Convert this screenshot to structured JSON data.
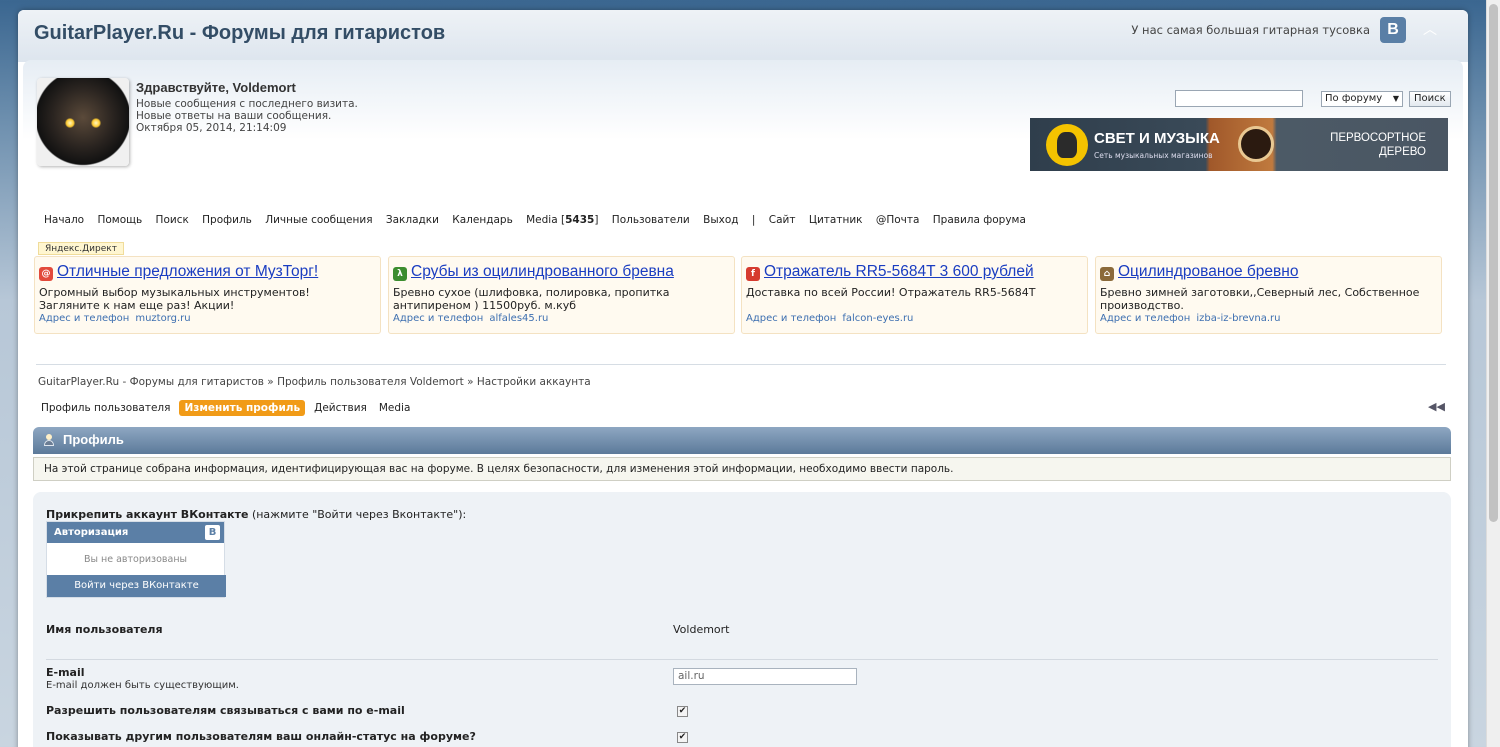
{
  "header": {
    "site_title": "GuitarPlayer.Ru - Форумы для гитаристов",
    "tagline": "У нас самая большая гитарная тусовка",
    "vk_letter": "B"
  },
  "user": {
    "greeting": "Здравствуйте, Voldemort",
    "new_since_visit": "Новые сообщения с последнего визита.",
    "new_replies": "Новые ответы на ваши сообщения.",
    "datetime": "Октября 05, 2014, 21:14:09"
  },
  "search": {
    "placeholder": "",
    "scope": "По форуму",
    "button": "Поиск"
  },
  "banner": {
    "brand": "СВЕТ И МУЗЫКА",
    "sub": "Сеть музыкальных магазинов",
    "line1": "ПЕРВОСОРТНОЕ",
    "line2": "ДЕРЕВО"
  },
  "nav": {
    "items": [
      "Начало",
      "Помощь",
      "Поиск",
      "Профиль",
      "Личные сообщения",
      "Закладки",
      "Календарь"
    ],
    "media_label": "Media [",
    "media_count": "5435",
    "media_close": "]",
    "after_media": [
      "Пользователи",
      "Выход",
      "|",
      "Сайт",
      "Цитатник",
      "@Почта",
      "Правила форума"
    ]
  },
  "ads": {
    "label": "Яндекс.Директ",
    "contact_label": "Адрес и телефон",
    "items": [
      {
        "title": "Отличные предложения от МузТорг!",
        "text": "Огромный выбор музыкальных инструментов! Загляните к нам еще раз! Акции!",
        "domain": "muztorg.ru",
        "icon_color": "#e24a3b",
        "icon_glyph": "@"
      },
      {
        "title": "Срубы из оцилиндрованного бревна",
        "text": "Бревно сухое (шлифовка, полировка, пропитка антипиреном ) 11500руб. м.куб",
        "domain": "alfales45.ru",
        "icon_color": "#3c8d2f",
        "icon_glyph": "λ"
      },
      {
        "title": "Отражатель RR5-5684T 3 600 рублей",
        "text": "Доставка по всей России! Отражатель RR5-5684T",
        "domain": "falcon-eyes.ru",
        "icon_color": "#d63b2f",
        "icon_glyph": "f"
      },
      {
        "title": "Оцилиндрованое бревно",
        "text": "Бревно зимней заготовки,,Северный лес, Собственное производство.",
        "domain": "izba-iz-brevna.ru",
        "icon_color": "#8b6a3a",
        "icon_glyph": "⌂"
      }
    ]
  },
  "breadcrumb": "GuitarPlayer.Ru - Форумы для гитаристов » Профиль пользователя Voldemort » Настройки аккаунта",
  "tabs": {
    "profile": "Профиль пользователя",
    "edit": "Изменить профиль",
    "actions": "Действия",
    "media": "Media"
  },
  "section": {
    "title": "Профиль",
    "info": "На этой странице собрана информация, идентифицирующая вас на форуме. В целях безопасности, для изменения этой информации, необходимо ввести пароль."
  },
  "form": {
    "vk_heading_bold": "Прикрепить аккаунт ВКонтакте",
    "vk_heading_rest": " (нажмите \"Войти через Вконтакте\"):",
    "vk_widget_title": "Авторизация",
    "vk_widget_logo": "B",
    "vk_status": "Вы не авторизованы",
    "vk_login": "Войти через ВКонтакте",
    "username_label": "Имя пользователя",
    "username_value": "Voldemort",
    "email_label": "E-mail",
    "email_hint": "E-mail должен быть существующим.",
    "email_value": "ail.ru",
    "allow_email_label": "Разрешить пользователям связываться с вами по e-mail",
    "allow_email_checked": "✔",
    "show_online_label": "Показывать другим пользователям ваш онлайн-статус на форуме?",
    "show_online_checked": "✔"
  }
}
